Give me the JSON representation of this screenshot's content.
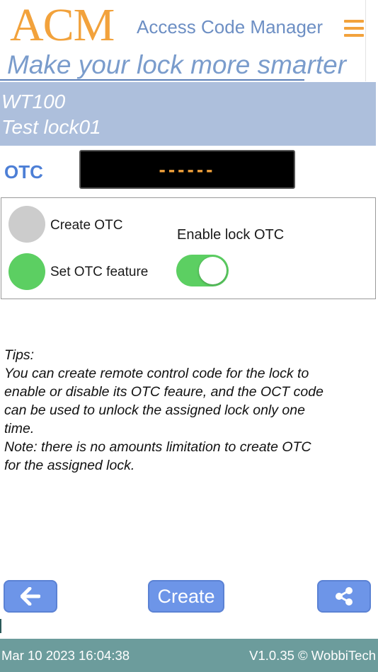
{
  "header": {
    "logo": "ACM",
    "app_name": "Access Code Manager",
    "slogan": "Make your lock more smarter",
    "menu_icon": "hamburger-menu-icon"
  },
  "lock": {
    "model": "WT100",
    "name": "Test lock01"
  },
  "otc": {
    "label": "OTC",
    "value": "------"
  },
  "options": {
    "create_label": "Create OTC",
    "create_selected": false,
    "set_label": "Set OTC feature",
    "set_selected": true,
    "enable_label": "Enable lock OTC",
    "enable_on": true
  },
  "tips": {
    "lines": [
      "Tips:",
      "You can create remote control code for the lock to",
      "enable or disable its OTC feaure, and the OCT code",
      "can be used to unlock the assigned lock only one",
      "time.",
      "Note: there is no amounts limitation to create OTC",
      "for the assigned lock."
    ]
  },
  "buttons": {
    "back_icon": "arrow-left-icon",
    "create_label": "Create",
    "share_icon": "share-icon"
  },
  "footer": {
    "datetime": "Mar 10 2023 16:04:38",
    "version": "V1.0.35 © WobbiTech"
  },
  "colors": {
    "accent_orange": "#f2a23c",
    "title_blue": "#6d8fc4",
    "band": "#adbfdc",
    "otc_label": "#4d7fd6",
    "toggle_green": "#5ccf62",
    "button_blue": "#6d95e8",
    "footer": "#6c9c9c"
  }
}
